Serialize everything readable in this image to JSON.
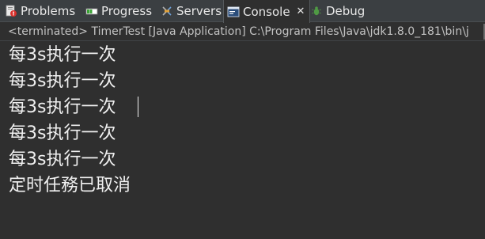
{
  "tabs": [
    {
      "label": "Problems",
      "icon": "problems-icon"
    },
    {
      "label": "Progress",
      "icon": "progress-icon"
    },
    {
      "label": "Servers",
      "icon": "servers-icon"
    },
    {
      "label": "Console",
      "icon": "console-icon",
      "active": true,
      "close": "✕"
    },
    {
      "label": "Debug",
      "icon": "debug-icon"
    }
  ],
  "console": {
    "header": "<terminated> TimerTest [Java Application] C:\\Program Files\\Java\\jdk1.8.0_181\\bin\\j",
    "lines": [
      "每3s执行一次",
      "每3s执行一次",
      "每3s执行一次",
      "每3s执行一次",
      "每3s执行一次",
      "定时任務已取消"
    ]
  },
  "colors": {
    "background": "#2f2f2f",
    "tabbar": "#3b3f42",
    "text": "#f0f0f0",
    "header_text": "#c2c2c2"
  }
}
